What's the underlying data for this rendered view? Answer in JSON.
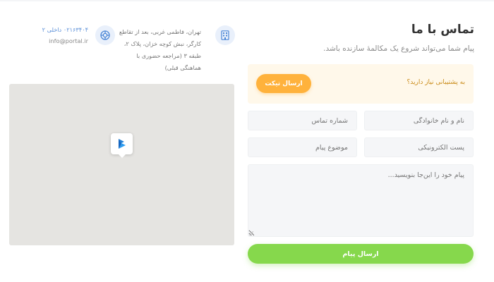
{
  "contact": {
    "title": "تماس با ما",
    "subtitle": "پیام شما می‌تواند شروع یک مکالمهٔ سازنده باشد."
  },
  "support": {
    "question": "به پشتیبانی نیاز دارید؟",
    "ticket_button": "ارسال تیکت"
  },
  "form": {
    "name_placeholder": "نام و نام خانوادگی",
    "phone_placeholder": "شماره تماس",
    "email_placeholder": "پست الکترونیکی",
    "subject_placeholder": "موضوع پیام",
    "message_placeholder": "پیام خود را این‌جا بنویسید...",
    "send_button": "ارسال پیام"
  },
  "info": {
    "address_lines": [
      "تهران، فاطمی غربی، بعد از تقاطع",
      "کارگر، نبش کوچه خزان، پلاک ۲،",
      "طبقه ۳ (مراجعه حضوری با",
      "هماهنگی قبلی)"
    ],
    "phone": "۰۲۱۶۳۴۰۴ داخلی ۲",
    "email": "info@portal.ir",
    "address_icon": "building-icon",
    "contact_icon": "support-lifebuoy-icon"
  },
  "map": {
    "pin_icon": "brand-logo-icon"
  },
  "colors": {
    "accent_orange": "#ffb23c",
    "accent_green": "#86d84c",
    "link_blue": "#5a8fd8",
    "support_bg": "#fff8ea",
    "map_bg": "#e5e4e1"
  }
}
